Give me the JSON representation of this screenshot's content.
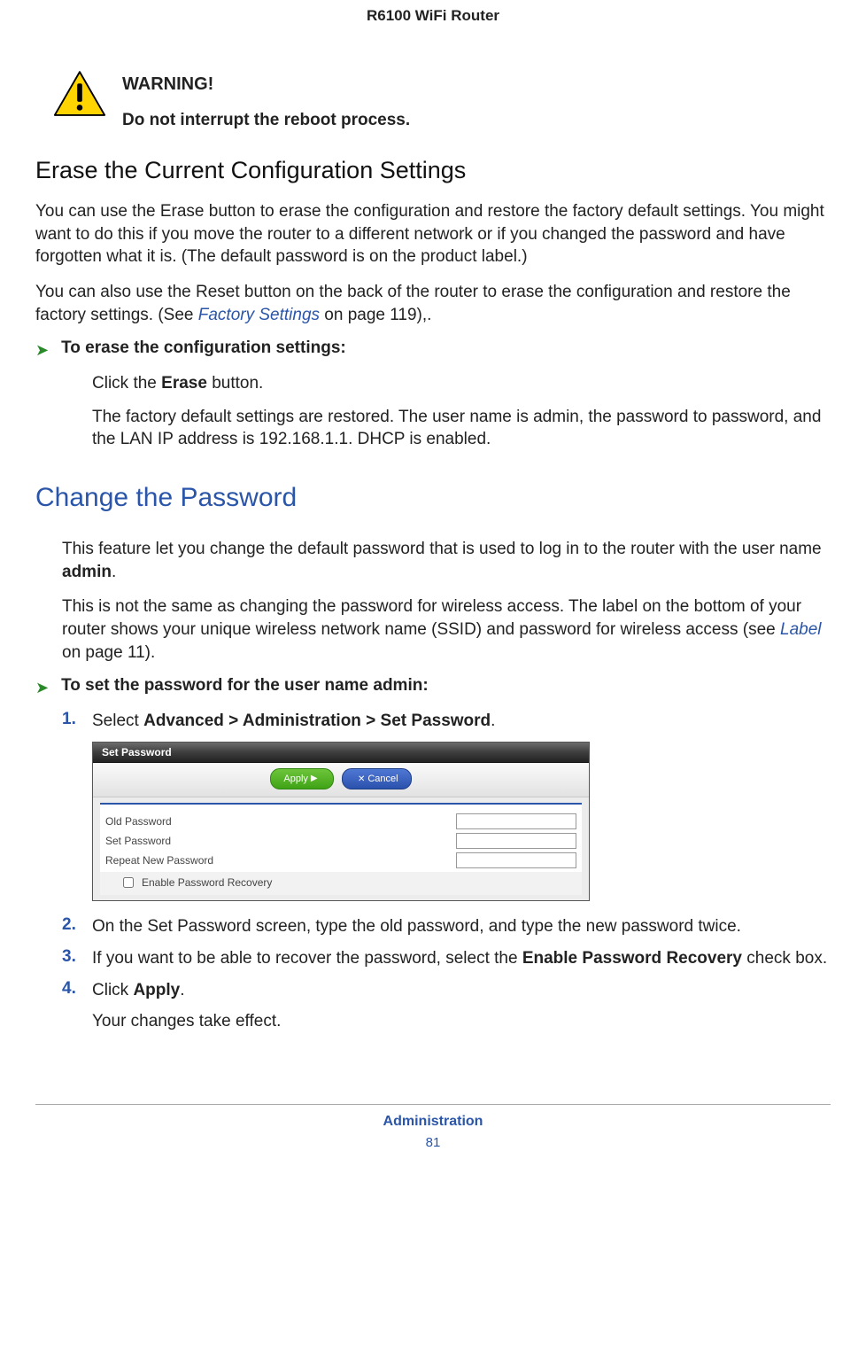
{
  "header": "R6100 WiFi Router",
  "warning": {
    "label": "WARNING!",
    "body": "Do not interrupt the reboot process."
  },
  "sec_erase": {
    "title": "Erase the Current Configuration Settings",
    "p1": "You can use the Erase button to erase the configuration and restore the factory default settings. You might want to do this if you move the router to a different network or if you changed the password and have forgotten what it is. (The default password is on the product label.)",
    "p2a": "You can also use the Reset button on the back of the router to erase the configuration and restore the factory settings. (See ",
    "p2link": "Factory Settings",
    "p2b": " on page 119),.",
    "proc_title": "To erase the configuration settings:",
    "step_a_pre": "Click the ",
    "step_a_bold": "Erase",
    "step_a_post": " button.",
    "step_b": "The factory default settings are restored. The user name is admin, the password to password, and the LAN IP address is 192.168.1.1. DHCP is enabled."
  },
  "sec_pass": {
    "title": "Change the Password",
    "p1a": "This feature let you change the default password that is used to log in to the router with the user name ",
    "p1b": "admin",
    "p1c": ".",
    "p2a": "This is not the same as changing the password for wireless access. The label on the bottom of your router shows your unique wireless network name (SSID) and password for wireless access (see ",
    "p2link": "Label",
    "p2b": " on page 11).",
    "proc_title": "To set the password for the user name admin:",
    "step1_pre": "Select ",
    "step1_bold": "Advanced > Administration > Set Password",
    "step1_post": ".",
    "step2": "On the Set Password screen, type the old password, and type the new password twice.",
    "step3_pre": "If you want to be able to recover the password, select the ",
    "step3_bold": "Enable Password Recovery",
    "step3_post": " check box.",
    "step4_pre": "Click ",
    "step4_bold": "Apply",
    "step4_post": ".",
    "step4_result": "Your changes take effect."
  },
  "ui": {
    "title": "Set Password",
    "apply": "Apply",
    "cancel": "Cancel",
    "old": "Old Password",
    "set": "Set Password",
    "repeat": "Repeat New Password",
    "recover": "Enable Password Recovery"
  },
  "footer": {
    "section": "Administration",
    "page": "81"
  },
  "nums": {
    "n1": "1.",
    "n2": "2.",
    "n3": "3.",
    "n4": "4."
  }
}
